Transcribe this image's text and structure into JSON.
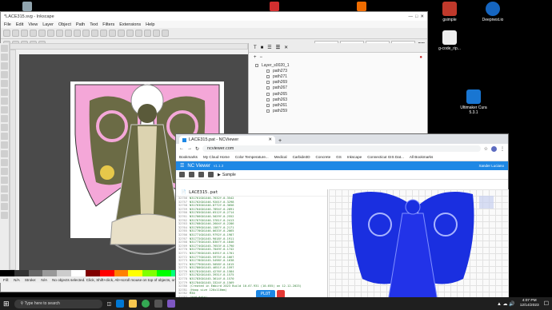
{
  "desktop": {
    "icons": [
      {
        "label": "gsimple",
        "color": "#c0392b"
      },
      {
        "label": "Deepnest.io",
        "color": "#1565c0"
      },
      {
        "label": "g-code_rip...",
        "color": "#eeeeee"
      },
      {
        "label": "Ultimaker Cura 5.3.1",
        "color": "#1976d2"
      }
    ]
  },
  "inkscape": {
    "title": "*LACE315.svg - Inkscape",
    "menu": [
      "File",
      "Edit",
      "View",
      "Layer",
      "Object",
      "Path",
      "Text",
      "Filters",
      "Extensions",
      "Help"
    ],
    "layers_tab": "Layers and Objects",
    "layer_name": "Layer_s0020_1",
    "paths": [
      "path273",
      "path271",
      "path269",
      "path267",
      "path265",
      "path263",
      "path261",
      "path259"
    ],
    "unit": "mm",
    "zoom": "N/A",
    "status": "No objects selected. Click, Shift+click, Alt+scroll mouse on top of objects, or drag around objects to select.",
    "fill_label": "Fill:",
    "stroke_label": "Stroke:",
    "fill_value": "N/A",
    "stroke_value": "N/A",
    "palette": [
      "#000000",
      "#333333",
      "#666666",
      "#999999",
      "#cccccc",
      "#ffffff",
      "#800000",
      "#ff0000",
      "#ff8000",
      "#ffff00",
      "#80ff00",
      "#00ff00",
      "#00ff80",
      "#00ffff",
      "#0080ff",
      "#0000ff",
      "#8000ff",
      "#ff00ff",
      "#ff0080",
      "#804000",
      "#808000",
      "#008080",
      "#000080",
      "#400080",
      "#ff8080",
      "#80ff80",
      "#8080ff",
      "#ffcc00",
      "#00cccc",
      "#cc00cc"
    ]
  },
  "chrome": {
    "tab_title": "LACE315.pat - NCViewer",
    "url": "ncviewer.com",
    "bookmarks": [
      "Bookmarks",
      "My Cloud Home",
      "Color Temperature...",
      "Medical",
      "Carbide3D",
      "Concrete",
      "GS",
      "Inkscape",
      "Connecticut GIS Dat...",
      "All Bookmarks"
    ],
    "app_title": "NC Viewer",
    "version": "v1.1.3",
    "user": "Xander Luciano",
    "file": "LACE315.pat",
    "sample_label": "Sample",
    "plot_label": "PLOT"
  },
  "code": {
    "lines": [
      {
        "n": "32756",
        "t": "N31761G01X46.7632Y-0.3542"
      },
      {
        "n": "32757",
        "t": "N31762G01X46.9201Y-0.3298"
      },
      {
        "n": "32758",
        "t": "N31763G01X46.8772Y-0.3056"
      },
      {
        "n": "32759",
        "t": "N31764G01X46.7894Y-0.2891"
      },
      {
        "n": "32760",
        "t": "N31765G01X46.6512Y-0.2714"
      },
      {
        "n": "32761",
        "t": "N31766G01X46.5029Y-0.2552"
      },
      {
        "n": "32762",
        "t": "N31767G01X46.3781Y-0.2413"
      },
      {
        "n": "32763",
        "t": "N31768G01X46.2604Y-0.2286"
      },
      {
        "n": "32764",
        "t": "N31769G01X46.1587Y-0.2171"
      },
      {
        "n": "32765",
        "t": "N31770G01X46.0633Y-0.2065"
      },
      {
        "n": "32766",
        "t": "N31771G01X45.9792Y-0.1987"
      },
      {
        "n": "32767",
        "t": "N31772G01X45.9018Y-0.1911"
      },
      {
        "n": "32768",
        "t": "N31773G01X45.8307Y-0.1846"
      },
      {
        "n": "32769",
        "t": "N31774G01X45.7653Y-0.1790"
      },
      {
        "n": "32770",
        "t": "N31775G01X45.7049Y-0.1742"
      },
      {
        "n": "32771",
        "t": "N31776G01X45.6491Y-0.1701"
      },
      {
        "n": "32772",
        "t": "N31777G01X45.5975Y-0.1667"
      },
      {
        "n": "32773",
        "t": "N31778G01X45.5498Y-0.1638"
      },
      {
        "n": "32774",
        "t": "N31779G01X45.5058Y-0.1615"
      },
      {
        "n": "32775",
        "t": "N31780G01X45.4651Y-0.1597"
      },
      {
        "n": "32776",
        "t": "N31781G01X45.4276Y-0.1584"
      },
      {
        "n": "32777",
        "t": "N31782G01X45.3931Y-0.1575"
      },
      {
        "n": "32778",
        "t": "N31783G01X45.3614Y-0.1570"
      },
      {
        "n": "32779",
        "t": "N31784G01X45.3324Y-0.1569"
      },
      {
        "n": "32780",
        "t": "(Created in Embird 2023 Build 10.67.931 (10-655) on 12-12-2023)"
      },
      {
        "n": "32781",
        "t": "(Hoop size 126x110mm)"
      },
      {
        "n": "32782",
        "t": "M30"
      },
      {
        "n": "32783",
        "t": "(end-data)"
      }
    ]
  },
  "taskbar": {
    "search_placeholder": "Type here to search",
    "time": "4:07 PM",
    "date": "12/14/2023"
  }
}
